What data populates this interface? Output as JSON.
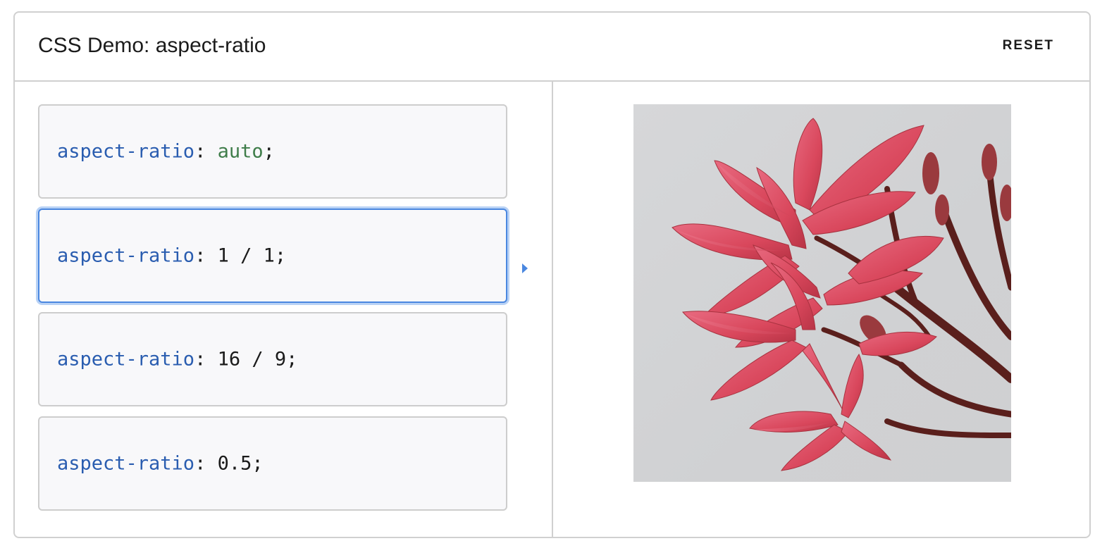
{
  "header": {
    "title": "CSS Demo: aspect-ratio",
    "reset_label": "RESET"
  },
  "choices": [
    {
      "property": "aspect-ratio",
      "colon": ": ",
      "value": "auto",
      "semicolon": ";",
      "selected": false
    },
    {
      "property": "aspect-ratio",
      "colon": ": ",
      "value": "1 / 1",
      "semicolon": ";",
      "selected": true
    },
    {
      "property": "aspect-ratio",
      "colon": ": ",
      "value": "16 / 9",
      "semicolon": ";",
      "selected": false
    },
    {
      "property": "aspect-ratio",
      "colon": ": ",
      "value": "0.5",
      "semicolon": ";",
      "selected": false
    }
  ],
  "preview": {
    "image_subject": "pink frangipani flowers on branches"
  },
  "colors": {
    "property": "#2a5db0",
    "keyword_value": "#3f7d4a",
    "selected_border": "#4a87e0",
    "border": "#d0d0d0"
  }
}
